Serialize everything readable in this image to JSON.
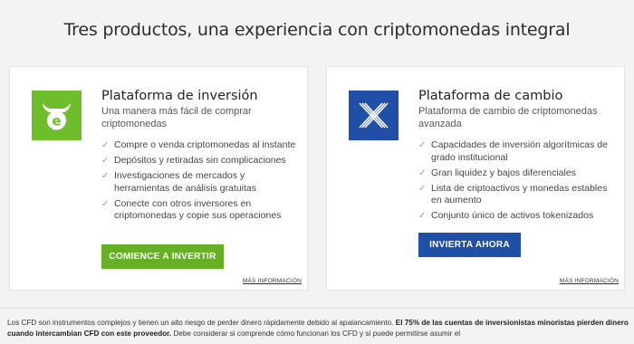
{
  "headline": "Tres productos, una experiencia con criptomonedas integral",
  "cards": [
    {
      "title": "Plataforma de inversión",
      "subtitle": "Una manera más fácil de comprar criptomonedas",
      "features": [
        "Compre o venda criptomonedas al instante",
        "Depósitos y retiradas sin complicaciones",
        " Investigaciones de mercados y herramientas de análisis gratuitas",
        " Conecte con otros inversores en criptomonedas y copie sus operaciones"
      ],
      "cta": "COMIENCE A INVERTIR",
      "more": "MÁS INFORMACIÓN",
      "accent": "#66b025",
      "icon": "etoro-bull-icon"
    },
    {
      "title": "Plataforma de cambio",
      "subtitle": "Plataforma de cambio de criptomonedas avanzada",
      "features": [
        "Capacidades de inversión algorítmicas de grado institucional",
        "Gran liquidez y bajos diferenciales",
        "Lista de criptoactivos y monedas estables en aumento",
        "Conjunto único de activos tokenizados"
      ],
      "cta": "INVIERTA AHORA",
      "more": "MÁS INFORMACIÓN",
      "accent": "#1f4fa6",
      "icon": "etorox-x-icon"
    }
  ],
  "disclaimer": {
    "part1": "Los CFD son instrumentos complejos y tienen un alto riesgo de perder dinero rápidamente debido al apalancamiento. ",
    "bold": "El 75% de las cuentas de inversionistas minoristas pierden dinero cuando intercambian CFD con este proveedor.",
    "part2": " Debe considerar si comprende cómo funcionan los CFD y si puede permitirse asumir el"
  }
}
